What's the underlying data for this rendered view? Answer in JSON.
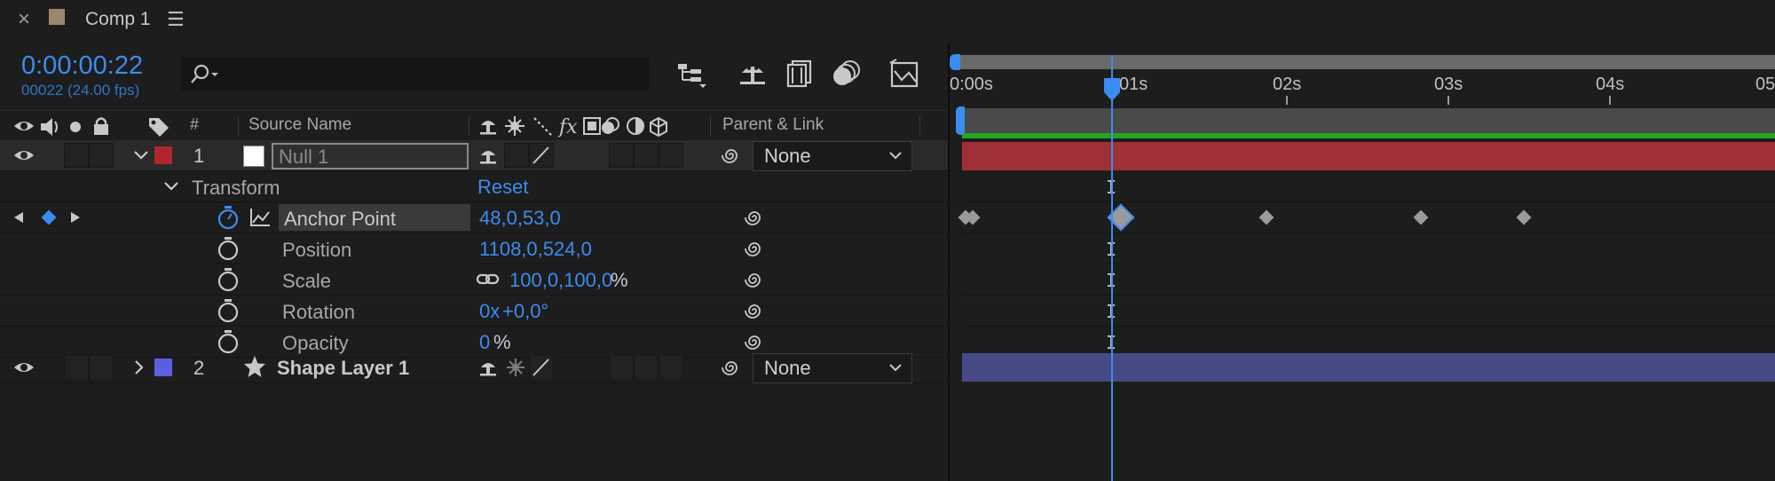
{
  "tab": {
    "close": "×",
    "title": "Comp 1",
    "menu": "☰"
  },
  "time": {
    "current": "0:00:00:22",
    "frames": "00022 (24.00 fps)"
  },
  "search": {
    "placeholder": ""
  },
  "columns": {
    "number": "#",
    "source_name": "Source Name",
    "parent_link": "Parent & Link"
  },
  "ruler": {
    "labels": [
      "0:00s",
      "01s",
      "02s",
      "03s",
      "04s",
      "05"
    ]
  },
  "layers": [
    {
      "number": "1",
      "name": "Null 1",
      "color": "#b1252f",
      "parent": "None",
      "expanded": true
    },
    {
      "number": "2",
      "name": "Shape Layer 1",
      "color": "#5b5fe0",
      "parent": "None",
      "expanded": false
    }
  ],
  "transform": {
    "label": "Transform",
    "reset": "Reset",
    "properties": [
      {
        "name": "Anchor Point",
        "value": "48,0,53,0"
      },
      {
        "name": "Position",
        "value": "1108,0,524,0"
      },
      {
        "name": "Scale",
        "value": "100,0,100,0",
        "unit": "%"
      },
      {
        "name": "Rotation",
        "value_prefix": "0x",
        "value": "+0,0°"
      },
      {
        "name": "Opacity",
        "value": "0",
        "unit": "%"
      }
    ]
  },
  "colors": {
    "accent": "#3b8cf0",
    "layer1_bar": "#a03038",
    "layer2_bar": "#454a86",
    "work_area": "#23a623"
  }
}
